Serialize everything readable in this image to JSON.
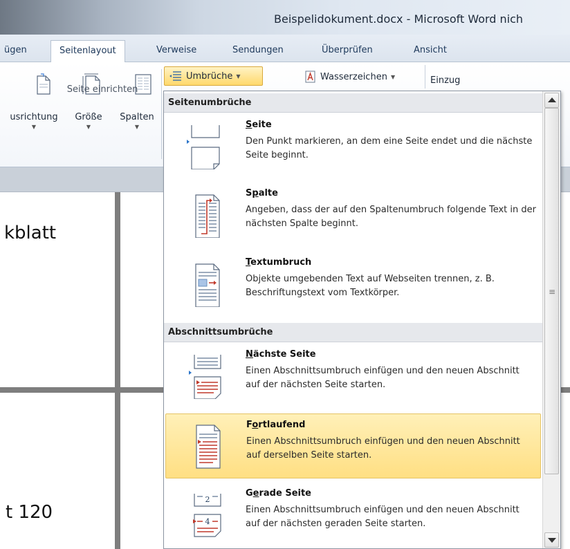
{
  "window": {
    "title": "Beispelidokument.docx - Microsoft Word nich"
  },
  "tabs": [
    {
      "label": "ügen"
    },
    {
      "label": "Seitenlayout",
      "active": true
    },
    {
      "label": "Verweise"
    },
    {
      "label": "Sendungen"
    },
    {
      "label": "Überprüfen"
    },
    {
      "label": "Ansicht"
    }
  ],
  "ribbon": {
    "buttons": {
      "orientation": "usrichtung",
      "size": "Größe",
      "columns": "Spalten"
    },
    "group_label": "Seite einrichten",
    "breaks_button": "Umbrüche",
    "watermark": "Wasserzeichen",
    "indent": "Einzug",
    "colors": {
      "breaks_highlight": "#ffd96b",
      "accent": "#1e395b"
    }
  },
  "document": {
    "line1": "kblatt",
    "line2": "t 120"
  },
  "dropdown": {
    "sections": [
      {
        "header": "Seitenumbrüche",
        "items": [
          {
            "title": "Seite",
            "mnemonic": "S",
            "rest": "eite",
            "icon": "page-break-icon",
            "description": "Den Punkt markieren, an dem eine Seite endet und die nächste Seite beginnt."
          },
          {
            "title": "Spalte",
            "mnemonic_pre": "S",
            "mnemonic": "p",
            "rest": "alte",
            "icon": "column-break-icon",
            "description": "Angeben, dass der auf den Spaltenumbruch folgende Text in der nächsten Spalte beginnt."
          },
          {
            "title": "Textumbruch",
            "mnemonic": "T",
            "rest": "extumbruch",
            "icon": "text-wrapping-break-icon",
            "description": "Objekte umgebenden Text auf Webseiten trennen, z. B. Beschriftungstext vom Textkörper."
          }
        ]
      },
      {
        "header": "Abschnittsumbrüche",
        "items": [
          {
            "title": "Nächste Seite",
            "mnemonic": "N",
            "rest": "ächste Seite",
            "icon": "next-page-section-icon",
            "description": "Einen Abschnittsumbruch einfügen und den neuen Abschnitt auf der nächsten Seite starten."
          },
          {
            "title": "Fortlaufend",
            "mnemonic_pre": "F",
            "mnemonic": "o",
            "rest": "rtlaufend",
            "icon": "continuous-section-icon",
            "highlighted": true,
            "description": "Einen Abschnittsumbruch einfügen und den neuen Abschnitt auf derselben Seite starten."
          },
          {
            "title": "Gerade Seite",
            "mnemonic_pre": "G",
            "mnemonic": "e",
            "rest": "rade Seite",
            "icon": "even-page-section-icon",
            "description": "Einen Abschnittsumbruch einfügen und den neuen Abschnitt auf der nächsten geraden Seite starten."
          }
        ]
      }
    ]
  }
}
